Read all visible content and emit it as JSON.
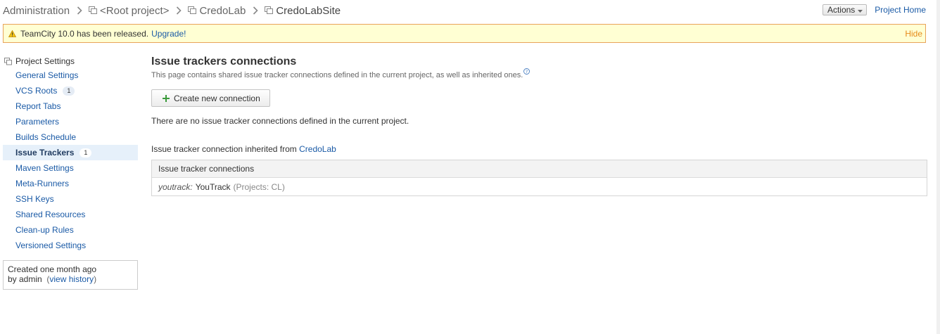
{
  "breadcrumb": {
    "items": [
      "Administration",
      "<Root project>",
      "CredoLab",
      "CredoLabSite"
    ]
  },
  "header": {
    "actions_label": "Actions",
    "project_home_label": "Project Home"
  },
  "banner": {
    "message": "TeamCity 10.0 has been released.",
    "upgrade_label": "Upgrade!",
    "hide_label": "Hide"
  },
  "sidebar": {
    "title": "Project Settings",
    "items": [
      {
        "label": "General Settings"
      },
      {
        "label": "VCS Roots",
        "badge": "1"
      },
      {
        "label": "Report Tabs"
      },
      {
        "label": "Parameters"
      },
      {
        "label": "Builds Schedule"
      },
      {
        "label": "Issue Trackers",
        "badge": "1",
        "active": true
      },
      {
        "label": "Maven Settings"
      },
      {
        "label": "Meta-Runners"
      },
      {
        "label": "SSH Keys"
      },
      {
        "label": "Shared Resources"
      },
      {
        "label": "Clean-up Rules"
      },
      {
        "label": "Versioned Settings"
      }
    ],
    "created": {
      "line1": "Created one month ago",
      "by_prefix": "by admin",
      "view_history_label": "view history"
    }
  },
  "main": {
    "title": "Issue trackers connections",
    "description": "This page contains shared issue tracker connections defined in the current project, as well as inherited ones.",
    "create_button_label": "Create new connection",
    "no_connections_text": "There are no issue tracker connections defined in the current project.",
    "inherited_prefix": "Issue tracker connection inherited from",
    "inherited_project": "CredoLab",
    "table": {
      "header": "Issue tracker connections",
      "rows": [
        {
          "type": "youtrack:",
          "name": "YouTrack",
          "projects": "(Projects: CL)"
        }
      ]
    }
  },
  "colors": {
    "link": "#1a5aa6",
    "banner_bg": "#ffffd3",
    "banner_border": "#e8a35a",
    "hide_orange": "#e68a1a",
    "active_bg": "#e6f0fa"
  }
}
